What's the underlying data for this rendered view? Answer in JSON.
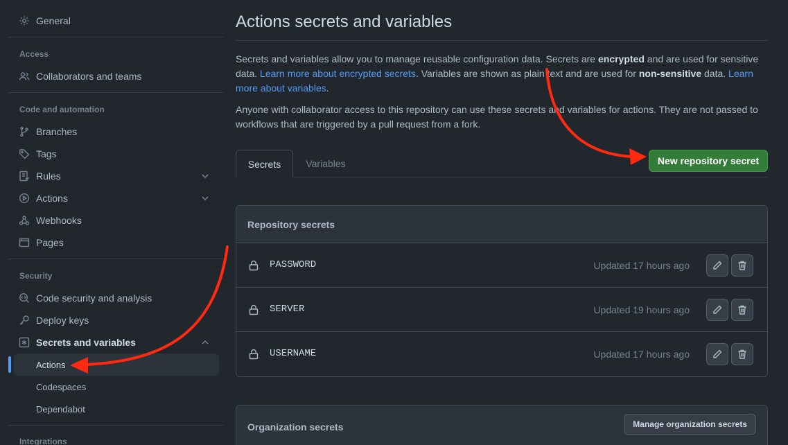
{
  "sidebar": {
    "general": "General",
    "access_heading": "Access",
    "collaborators": "Collaborators and teams",
    "code_heading": "Code and automation",
    "branches": "Branches",
    "tags": "Tags",
    "rules": "Rules",
    "actions": "Actions",
    "webhooks": "Webhooks",
    "pages": "Pages",
    "security_heading": "Security",
    "code_security": "Code security and analysis",
    "deploy_keys": "Deploy keys",
    "secrets_vars": "Secrets and variables",
    "sub_actions": "Actions",
    "sub_codespaces": "Codespaces",
    "sub_dependabot": "Dependabot",
    "integrations_heading": "Integrations"
  },
  "main": {
    "title": "Actions secrets and variables",
    "desc1_part1": "Secrets and variables allow you to manage reusable configuration data. Secrets are ",
    "desc1_bold1": "encrypted",
    "desc1_part2": " and are used for sensitive data. ",
    "desc1_link1": "Learn more about encrypted secrets",
    "desc1_part3": ". Variables are shown as plain text and are used for ",
    "desc1_bold2": "non-sensitive",
    "desc1_part4": " data. ",
    "desc1_link2": "Learn more about variables",
    "desc1_part5": ".",
    "desc2": "Anyone with collaborator access to this repository can use these secrets and variables for actions. They are not passed to workflows that are triggered by a pull request from a fork.",
    "tabs": [
      {
        "label": "Secrets"
      },
      {
        "label": "Variables"
      }
    ],
    "new_secret_button": "New repository secret",
    "repo_secrets_heading": "Repository secrets",
    "secrets": [
      {
        "name": "PASSWORD",
        "updated": "Updated 17 hours ago"
      },
      {
        "name": "SERVER",
        "updated": "Updated 19 hours ago"
      },
      {
        "name": "USERNAME",
        "updated": "Updated 17 hours ago"
      }
    ],
    "org_secrets_heading": "Organization secrets",
    "manage_org_button": "Manage organization secrets"
  },
  "colors": {
    "accent_green": "#347d39",
    "link_blue": "#539bf5",
    "annotation_red": "#ff2a10"
  }
}
